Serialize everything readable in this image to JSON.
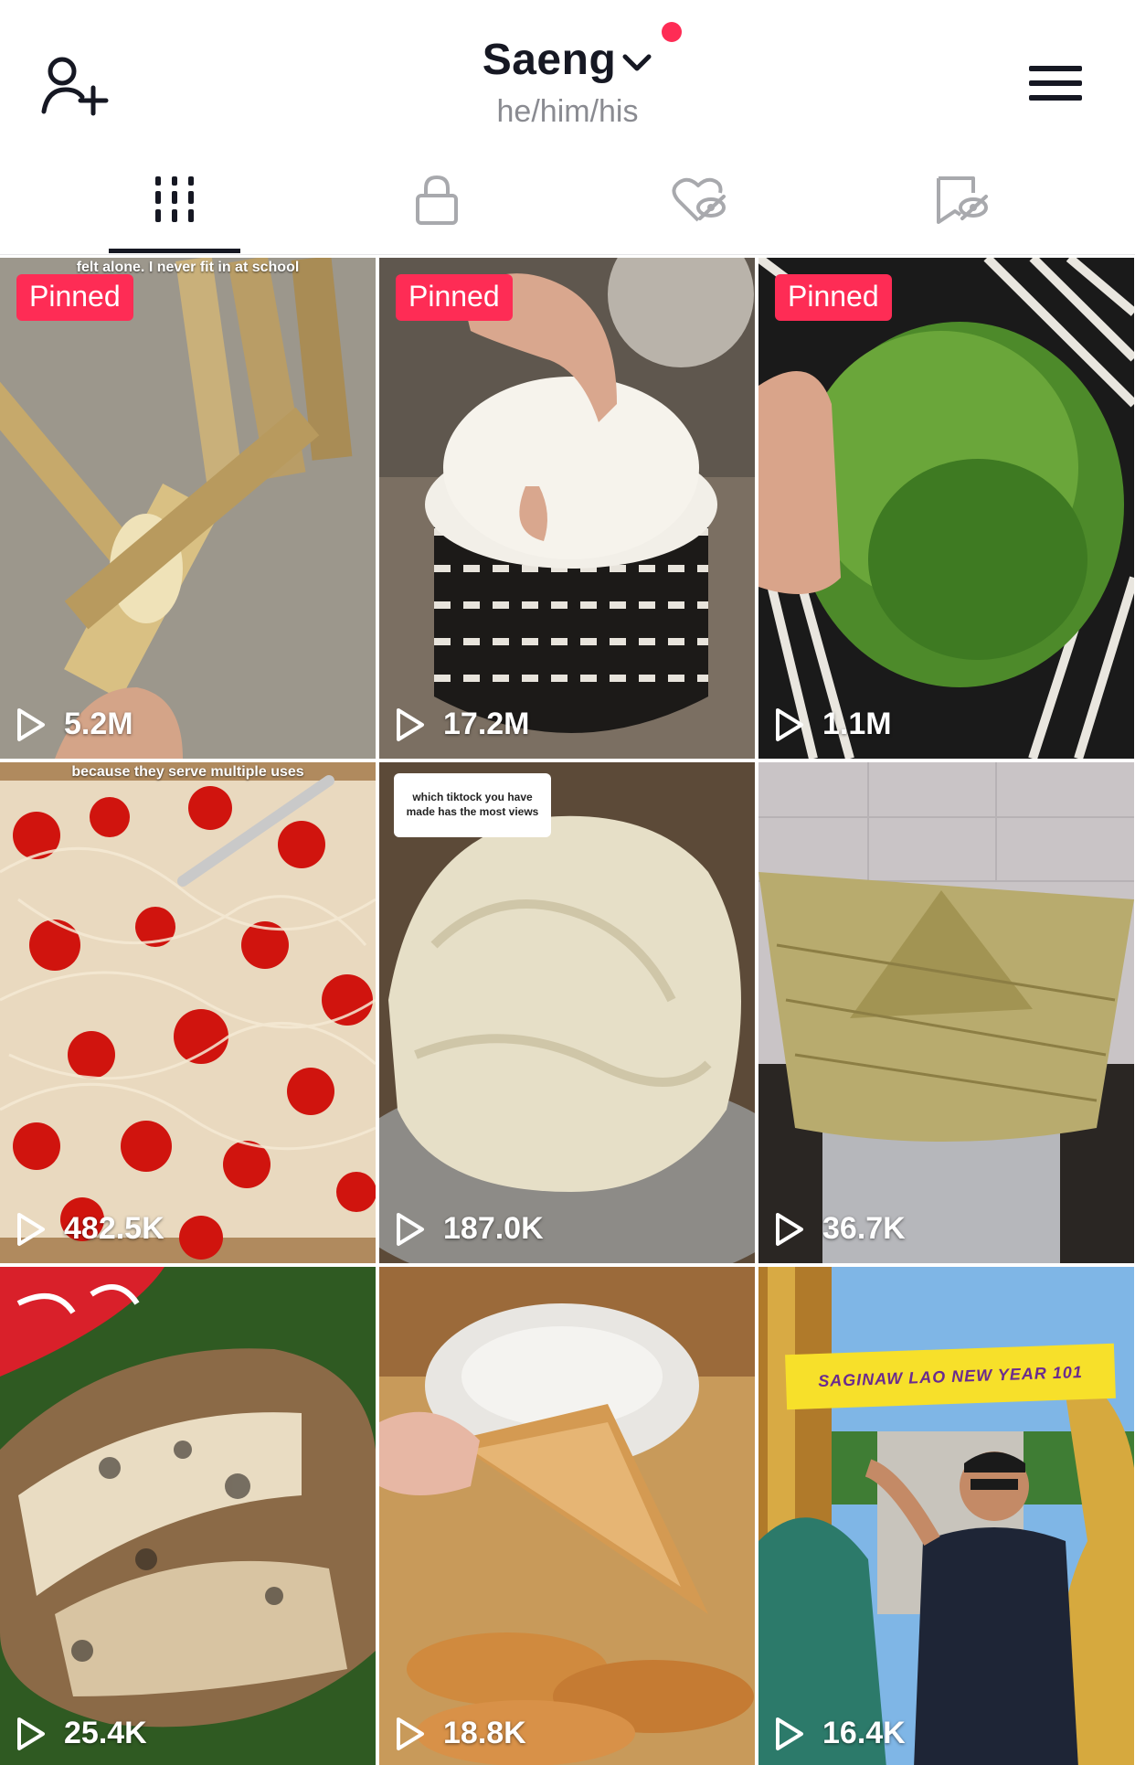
{
  "header": {
    "username": "Saeng",
    "pronouns": "he/him/his"
  },
  "tabs": [
    {
      "id": "videos",
      "icon": "grid-icon",
      "active": true
    },
    {
      "id": "private",
      "icon": "lock-icon",
      "active": false
    },
    {
      "id": "liked",
      "icon": "hidden-heart-icon",
      "active": false
    },
    {
      "id": "favorites",
      "icon": "hidden-bookmark-icon",
      "active": false
    }
  ],
  "videos": [
    {
      "views": "5.2M",
      "pinned": "Pinned",
      "caption": "felt alone. I never fit in at school"
    },
    {
      "views": "17.2M",
      "pinned": "Pinned"
    },
    {
      "views": "1.1M",
      "pinned": "Pinned"
    },
    {
      "views": "482.5K",
      "caption": "because they serve multiple uses"
    },
    {
      "views": "187.0K",
      "card": "which tiktock you have made has the most views"
    },
    {
      "views": "36.7K"
    },
    {
      "views": "25.4K"
    },
    {
      "views": "18.8K"
    },
    {
      "views": "16.4K",
      "banner": "SAGINAW LAO NEW YEAR 101"
    }
  ],
  "colors": {
    "accent": "#fe2c55",
    "text": "#161823",
    "muted": "#8a8b91"
  }
}
